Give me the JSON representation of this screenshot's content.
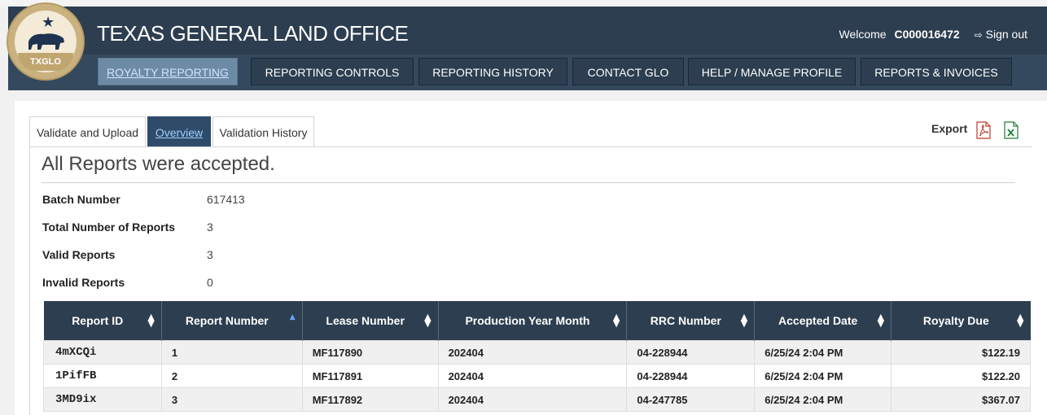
{
  "header": {
    "site_title": "TEXAS GENERAL LAND OFFICE",
    "logo_text": "TXGLO",
    "welcome_label": "Welcome",
    "username": "C000016472",
    "signout_label": "Sign out"
  },
  "nav": [
    {
      "label": "ROYALTY REPORTING",
      "active": true
    },
    {
      "label": "REPORTING CONTROLS"
    },
    {
      "label": "REPORTING HISTORY"
    },
    {
      "label": "CONTACT GLO"
    },
    {
      "label": "HELP / MANAGE PROFILE"
    },
    {
      "label": "REPORTS & INVOICES"
    }
  ],
  "tabs": [
    {
      "label": "Validate and Upload"
    },
    {
      "label": "Overview",
      "active": true
    },
    {
      "label": "Validation History"
    }
  ],
  "export_label": "Export",
  "headline": "All Reports were accepted.",
  "summary": [
    {
      "label": "Batch Number",
      "value": "617413"
    },
    {
      "label": "Total Number of Reports",
      "value": "3"
    },
    {
      "label": "Valid Reports",
      "value": "3"
    },
    {
      "label": "Invalid Reports",
      "value": "0"
    }
  ],
  "table": {
    "columns": [
      "Report ID",
      "Report Number",
      "Lease Number",
      "Production Year Month",
      "RRC Number",
      "Accepted Date",
      "Royalty Due"
    ],
    "rows": [
      [
        "4mXCQi",
        "1",
        "MF117890",
        "202404",
        "04-228944",
        "6/25/24 2:04 PM",
        "$122.19"
      ],
      [
        "1PifFB",
        "2",
        "MF117891",
        "202404",
        "04-228944",
        "6/25/24 2:04 PM",
        "$122.20"
      ],
      [
        "3MD9ix",
        "3",
        "MF117892",
        "202404",
        "04-247785",
        "6/25/24 2:04 PM",
        "$367.07"
      ]
    ]
  },
  "colors": {
    "header_bg": "#2d3e50",
    "nav_active_bg": "#6e8ba5",
    "tab_active_bg": "#2f4b6a"
  }
}
